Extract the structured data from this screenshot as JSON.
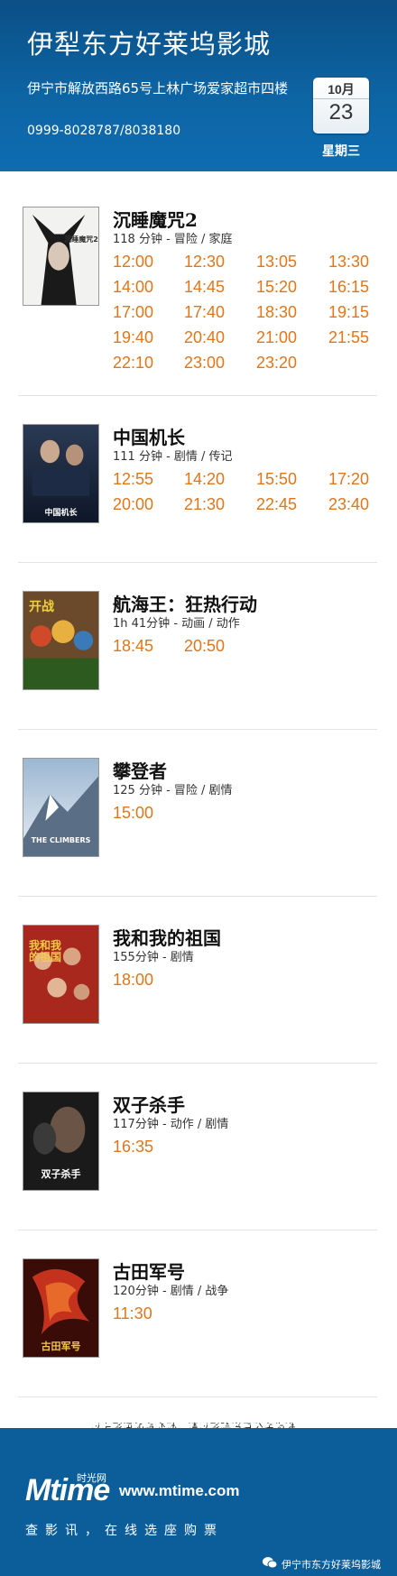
{
  "header": {
    "cinema_name": "伊犁东方好莱坞影城",
    "address": "伊宁市解放西路65号上林广场爱家超市四楼",
    "phone": "0999-8028787/8038180",
    "month": "10月",
    "day": "23",
    "weekday": "星期三"
  },
  "movies": [
    {
      "title": "沉睡魔咒2",
      "meta": "118 分钟 - 冒险 / 家庭",
      "times": [
        "12:00",
        "12:30",
        "13:05",
        "13:30",
        "14:00",
        "14:45",
        "15:20",
        "16:15",
        "17:00",
        "17:40",
        "18:30",
        "19:15",
        "19:40",
        "20:40",
        "21:00",
        "21:55",
        "22:10",
        "23:00",
        "23:20"
      ],
      "poster_text": "沉睡魔咒2"
    },
    {
      "title": "中国机长",
      "meta": "111 分钟 - 剧情 / 传记",
      "times": [
        "12:55",
        "14:20",
        "15:50",
        "17:20",
        "20:00",
        "21:30",
        "22:45",
        "23:40"
      ],
      "poster_text": "中国机长"
    },
    {
      "title": "航海王：狂热行动",
      "meta": "1h 41分钟 - 动画 / 动作",
      "times": [
        "18:45",
        "20:50"
      ],
      "poster_text": "开战"
    },
    {
      "title": "攀登者",
      "meta": "125 分钟 - 冒险 / 剧情",
      "times": [
        "15:00"
      ],
      "poster_text": "THE CLIMBERS"
    },
    {
      "title": "我和我的祖国",
      "meta": "155分钟 - 剧情",
      "times": [
        "18:00"
      ],
      "poster_text": "我和我的祖国"
    },
    {
      "title": "双子杀手",
      "meta": "117分钟 - 动作 / 剧情",
      "times": [
        "16:35"
      ],
      "poster_text": "双子杀手"
    },
    {
      "title": "古田军号",
      "meta": "120分钟 - 剧情 / 战争",
      "times": [
        "11:30"
      ],
      "poster_text": "古田军号"
    }
  ],
  "notice": "以上影讯如有变动，请以影院当日公布为准。",
  "footer": {
    "logo": "Mtime",
    "logo_cn": "时光网",
    "url": "www.mtime.com",
    "slogan": "查影讯，在线选座购票",
    "wechat_account": "伊宁市东方好莱坞影城"
  },
  "colors": {
    "header_blue": "#0d64a3",
    "showtime_orange": "#e0761a"
  }
}
